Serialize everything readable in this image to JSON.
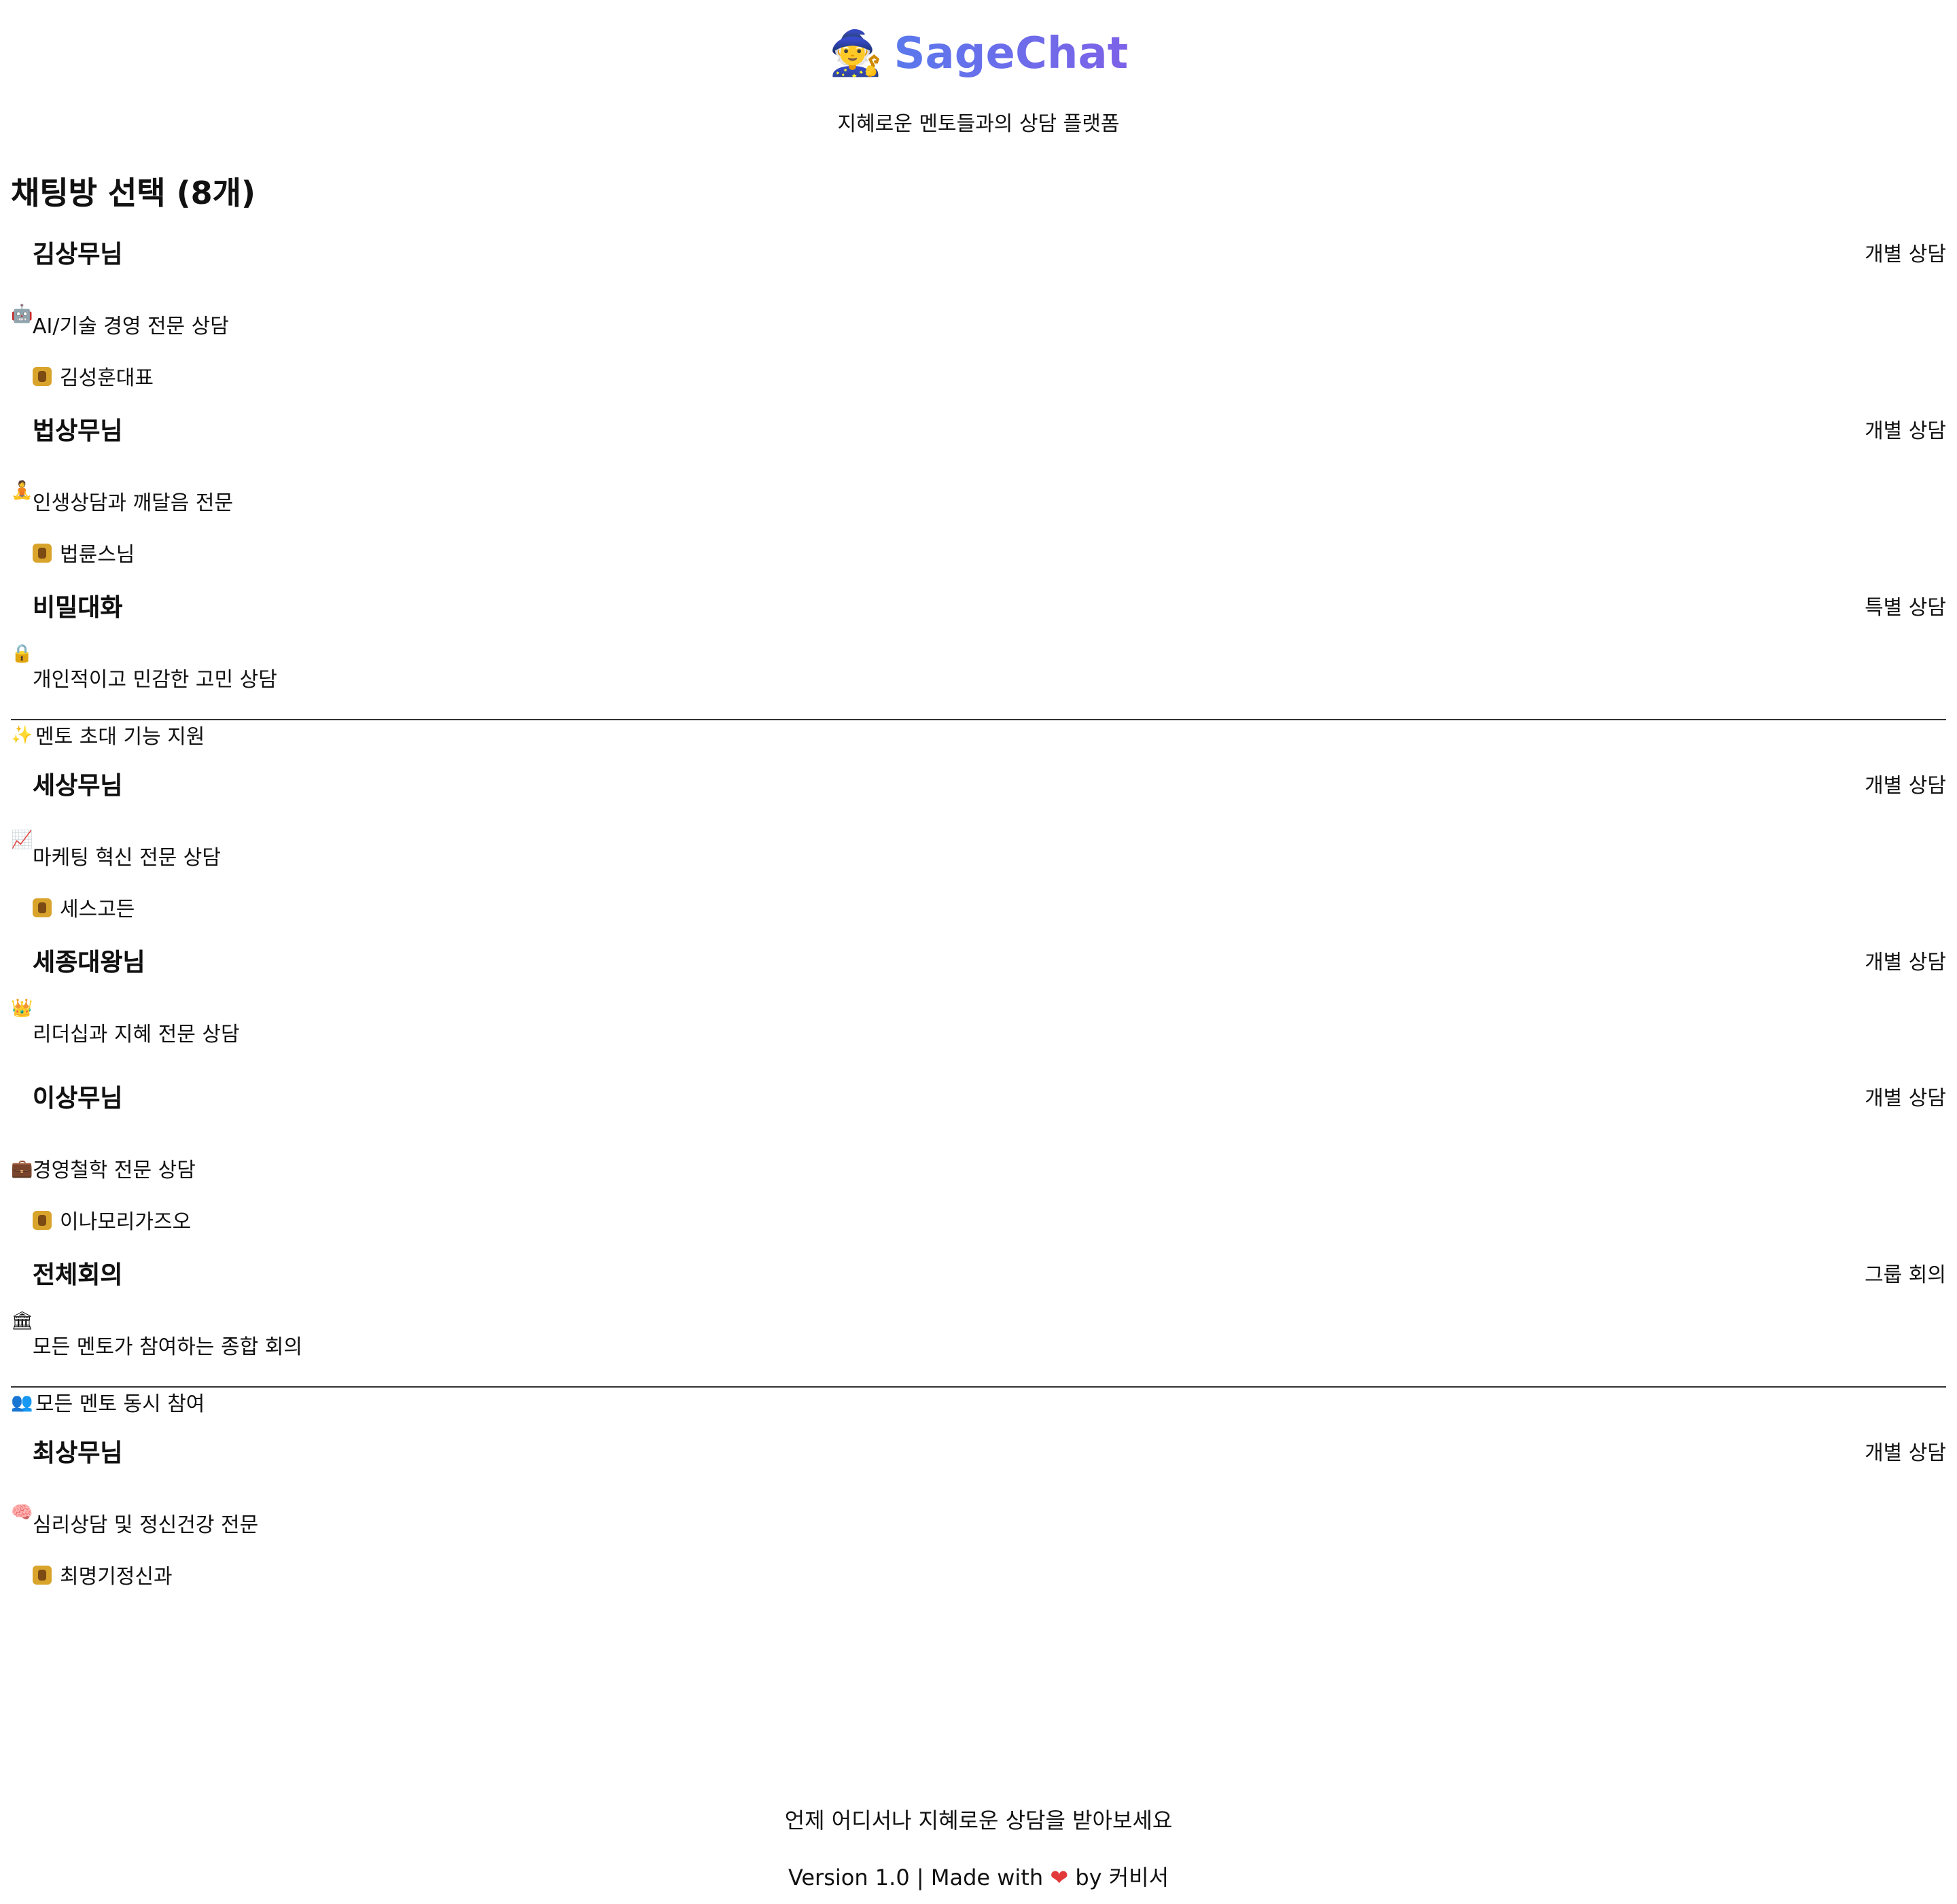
{
  "header": {
    "logo_icon": "🧙",
    "title": "SageChat",
    "subtitle": "지혜로운 멘토들과의 상담 플랫폼"
  },
  "section": {
    "heading": "채팅방 선택 (8개)"
  },
  "rooms": [
    {
      "icon": "🤖",
      "name": "김상무님",
      "tag": "개별 상담",
      "desc": "AI/기술 경영 전문 상담",
      "mentor": "김성훈대표"
    },
    {
      "icon": "🧘",
      "name": "법상무님",
      "tag": "개별 상담",
      "desc": "인생상담과 깨달음 전문",
      "mentor": "법륜스님"
    },
    {
      "icon": "🔒",
      "name": "비밀대화",
      "tag": "특별 상담",
      "desc": "개인적이고 민감한 고민 상담",
      "feature_icon": "✨",
      "feature": "멘토 초대 기능 지원"
    },
    {
      "icon": "📈",
      "name": "세상무님",
      "tag": "개별 상담",
      "desc": "마케팅 혁신 전문 상담",
      "mentor": "세스고든"
    },
    {
      "icon": "👑",
      "name": "세종대왕님",
      "tag": "개별 상담",
      "desc": "리더십과 지혜 전문 상담"
    },
    {
      "icon": "💼",
      "name": "이상무님",
      "tag": "개별 상담",
      "desc": "경영철학 전문 상담",
      "mentor": "이나모리가즈오"
    },
    {
      "icon": "🏛",
      "name": "전체회의",
      "tag": "그룹 회의",
      "desc": "모든 멘토가 참여하는 종합 회의",
      "feature_icon": "👥",
      "feature": "모든 멘토 동시 참여"
    },
    {
      "icon": "🧠",
      "name": "최상무님",
      "tag": "개별 상담",
      "desc": "심리상담 및 정신건강 전문",
      "mentor": "최명기정신과"
    }
  ],
  "footer": {
    "tagline": "언제 어디서나 지혜로운 상담을 받아보세요",
    "version": "Version 1.0",
    "separator": "|",
    "made_with": "Made with",
    "heart": "❤",
    "by": "by 커비서"
  },
  "colors": {
    "title_gradient_start": "#5a78ec",
    "title_gradient_end": "#7d62e8",
    "heart": "#e23a3a"
  }
}
